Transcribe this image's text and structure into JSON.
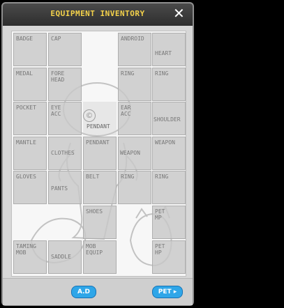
{
  "window": {
    "title": "EQUIPMENT INVENTORY",
    "close_glyph": "✕"
  },
  "slots": [
    {
      "label": "BADGE"
    },
    {
      "label": "CAP"
    },
    {
      "label": "ANDROID"
    },
    {
      "label": "HEART"
    },
    {
      "label": "MEDAL"
    },
    {
      "label": "FORE HEAD"
    },
    {
      "label": "RING"
    },
    {
      "label": "RING"
    },
    {
      "label": "POCKET"
    },
    {
      "label": "EYE ACC"
    },
    {
      "label": "PENDANT"
    },
    {
      "label": "EAR ACC"
    },
    {
      "label": "SHOULDER"
    },
    {
      "label": "MANTLE"
    },
    {
      "label": "CLOTHES"
    },
    {
      "label": "PENDANT"
    },
    {
      "label": "WEAPON"
    },
    {
      "label": "WEAPON"
    },
    {
      "label": "GLOVES"
    },
    {
      "label": "PANTS"
    },
    {
      "label": "BELT"
    },
    {
      "label": "RING"
    },
    {
      "label": "RING"
    },
    {
      "label": "SHOES"
    },
    {
      "label": "PET MP"
    },
    {
      "label": "TAMING MOB"
    },
    {
      "label": "SADDLE"
    },
    {
      "label": "MOB EQUIP"
    },
    {
      "label": "PET HP"
    }
  ],
  "footer": {
    "ad_label": "A.D",
    "pet_label": "PET"
  },
  "colors": {
    "accent": "#2fa6e8",
    "title": "#f4d24a"
  }
}
